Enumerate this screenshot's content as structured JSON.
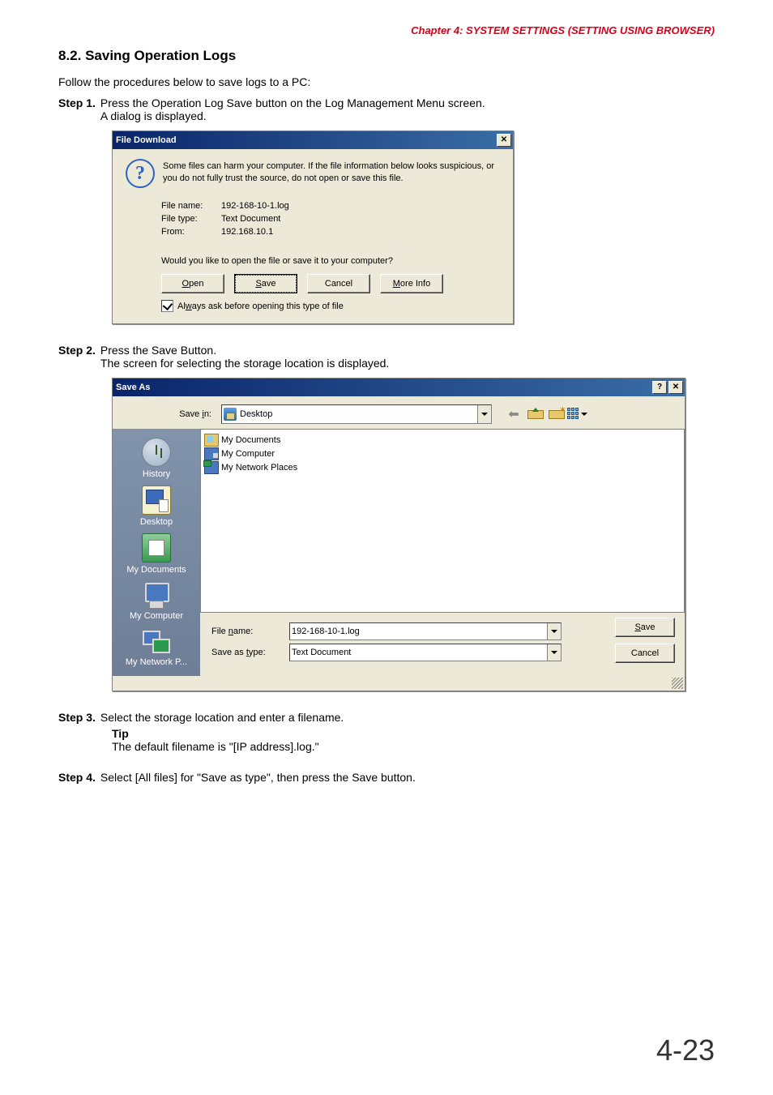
{
  "chapter_header": "Chapter 4:  SYSTEM SETTINGS (SETTING USING BROWSER)",
  "section_title": "8.2. Saving Operation Logs",
  "intro": "Follow the procedures below to save logs to a PC:",
  "steps": {
    "s1_label": "Step 1.",
    "s1_line1": "Press the Operation Log Save button on the Log Management Menu screen.",
    "s1_line2": "A dialog is displayed.",
    "s2_label": "Step 2.",
    "s2_line1": "Press the Save Button.",
    "s2_line2": "The screen for selecting the storage location is displayed.",
    "s3_label": "Step 3.",
    "s3_line1": "Select the storage location and enter a filename.",
    "tip_label": "Tip",
    "tip_text": "The default filename is \"[IP address].log.\"",
    "s4_label": "Step 4.",
    "s4_line1": "Select [All files] for \"Save as type\", then press the Save button."
  },
  "fd": {
    "title": "File Download",
    "close_glyph": "✕",
    "warn": "Some files can harm your computer. If the file information below looks suspicious, or you do not fully trust the source, do not open or save this file.",
    "k_filename": "File name:",
    "v_filename": "192-168-10-1.log",
    "k_filetype": "File type:",
    "v_filetype": "Text Document",
    "k_from": "From:",
    "v_from": "192.168.10.1",
    "prompt": "Would you like to open the file or save it to your computer?",
    "btn_open": "Open",
    "btn_save": "Save",
    "btn_cancel": "Cancel",
    "btn_more": "More Info",
    "chk_label": "Always ask before opening this type of file"
  },
  "sa": {
    "title": "Save As",
    "help_glyph": "?",
    "close_glyph": "✕",
    "savein_label": "Save in:",
    "savein_value": "Desktop",
    "side": {
      "history": "History",
      "desktop": "Desktop",
      "docs": "My Documents",
      "comp": "My Computer",
      "net": "My Network P..."
    },
    "list": {
      "i1": "My Documents",
      "i2": "My Computer",
      "i3": "My Network Places"
    },
    "filename_label": "File name:",
    "filename_value": "192-168-10-1.log",
    "type_label": "Save as type:",
    "type_value": "Text Document",
    "btn_save": "Save",
    "btn_cancel": "Cancel"
  },
  "page_number": "4-23"
}
